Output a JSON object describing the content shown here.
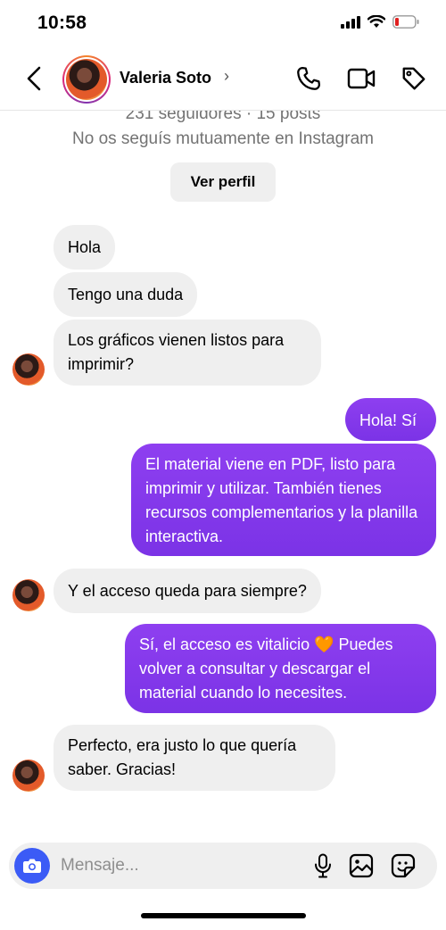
{
  "status_bar": {
    "time": "10:58",
    "icons": [
      "signal-icon",
      "wifi-icon",
      "battery-icon"
    ],
    "battery_color": "#e02020"
  },
  "header": {
    "contact_name": "Valeria Soto",
    "name_chevron": "›",
    "icons": [
      "back-icon",
      "phone-icon",
      "video-icon",
      "tag-icon"
    ]
  },
  "profile": {
    "stats": "231 seguidores · 15 posts",
    "note": "No os seguís mutuamente en Instagram",
    "view_profile_label": "Ver perfil"
  },
  "messages": [
    {
      "from": "them",
      "text": "Hola"
    },
    {
      "from": "them",
      "text": "Tengo una duda"
    },
    {
      "from": "them",
      "text": "Los gráficos vienen listos para imprimir?"
    },
    {
      "from": "me",
      "text": "Hola! Sí"
    },
    {
      "from": "me",
      "text": "El material viene en PDF, listo para imprimir y utilizar. También tienes recursos complementarios y la planilla interactiva."
    },
    {
      "from": "them",
      "text": "Y el acceso queda para siempre?"
    },
    {
      "from": "me",
      "text": "Sí, el acceso es vitalicio 🧡 Puedes volver a consultar y descargar el material cuando lo necesites."
    },
    {
      "from": "them",
      "text": "Perfecto, era justo lo que quería saber. Gracias!"
    }
  ],
  "composer": {
    "placeholder": "Mensaje...",
    "icons": [
      "camera-icon",
      "microphone-icon",
      "gallery-icon",
      "sticker-icon"
    ]
  },
  "colors": {
    "outgoing_bubble": "#8a3cef",
    "incoming_bubble": "#efefef",
    "camera_button": "#3b5bf6"
  }
}
